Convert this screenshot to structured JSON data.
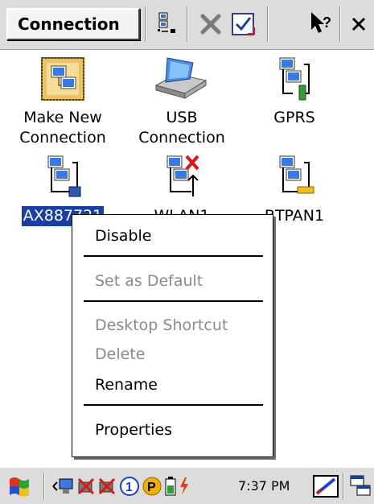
{
  "commandbar": {
    "title": "Connection",
    "icons": [
      "view-toggle-icon",
      "delete-icon",
      "ok-checkbox-icon",
      "help-icon",
      "close-icon"
    ]
  },
  "connections": [
    {
      "label": "Make New\nConnection",
      "icon": "make-new-connection-icon"
    },
    {
      "label": "USB\nConnection",
      "icon": "usb-connection-icon"
    },
    {
      "label": "GPRS",
      "icon": "gprs-icon"
    },
    {
      "label": "AX887721",
      "icon": "network-adapter-icon",
      "selected": true
    },
    {
      "label": "WLAN1",
      "icon": "wlan-disconnected-icon"
    },
    {
      "label": "BTPAN1",
      "icon": "bluetooth-pan-icon"
    }
  ],
  "context_menu": {
    "disable": "Disable",
    "set_default": "Set as Default",
    "desktop_shortcut": "Desktop Shortcut",
    "delete": "Delete",
    "rename": "Rename",
    "properties": "Properties"
  },
  "taskbar": {
    "clock": "7:37 PM",
    "icons": [
      "start-flag-icon",
      "network-connected-icon",
      "network-error-icon",
      "network-error-icon",
      "number-one-icon",
      "parking-icon",
      "battery-icon",
      "power-plug-icon",
      "input-panel-icon",
      "switch-window-icon"
    ]
  }
}
